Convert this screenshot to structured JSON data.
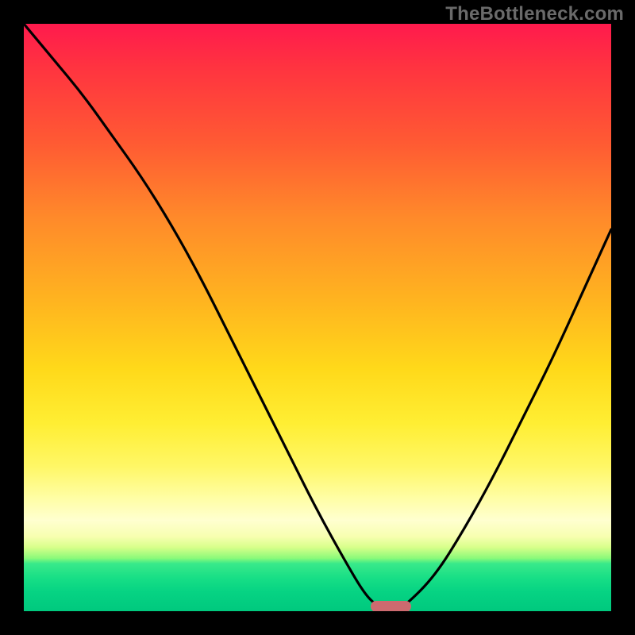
{
  "watermark": "TheBottleneck.com",
  "colors": {
    "frame": "#000000",
    "curve": "#000000",
    "marker": "#cd6a6f"
  },
  "chart_data": {
    "type": "line",
    "title": "",
    "xlabel": "",
    "ylabel": "",
    "xlim": [
      0,
      100
    ],
    "ylim": [
      0,
      100
    ],
    "grid": false,
    "legend": false,
    "series": [
      {
        "name": "bottleneck-curve",
        "x": [
          0,
          5,
          10,
          15,
          20,
          25,
          30,
          35,
          40,
          45,
          50,
          55,
          58,
          60,
          62,
          63,
          65,
          70,
          75,
          80,
          85,
          90,
          95,
          100
        ],
        "y": [
          100,
          94,
          88,
          81,
          74,
          66,
          57,
          47,
          37,
          27,
          17,
          8,
          3,
          1,
          0,
          0,
          1,
          6,
          14,
          23,
          33,
          43,
          54,
          65
        ]
      }
    ],
    "marker": {
      "x_start": 59,
      "x_end": 66,
      "y": 0
    },
    "background_gradient": {
      "top": "#ff1a4d",
      "mid": "#ffee33",
      "bottom": "#00c97e"
    }
  }
}
